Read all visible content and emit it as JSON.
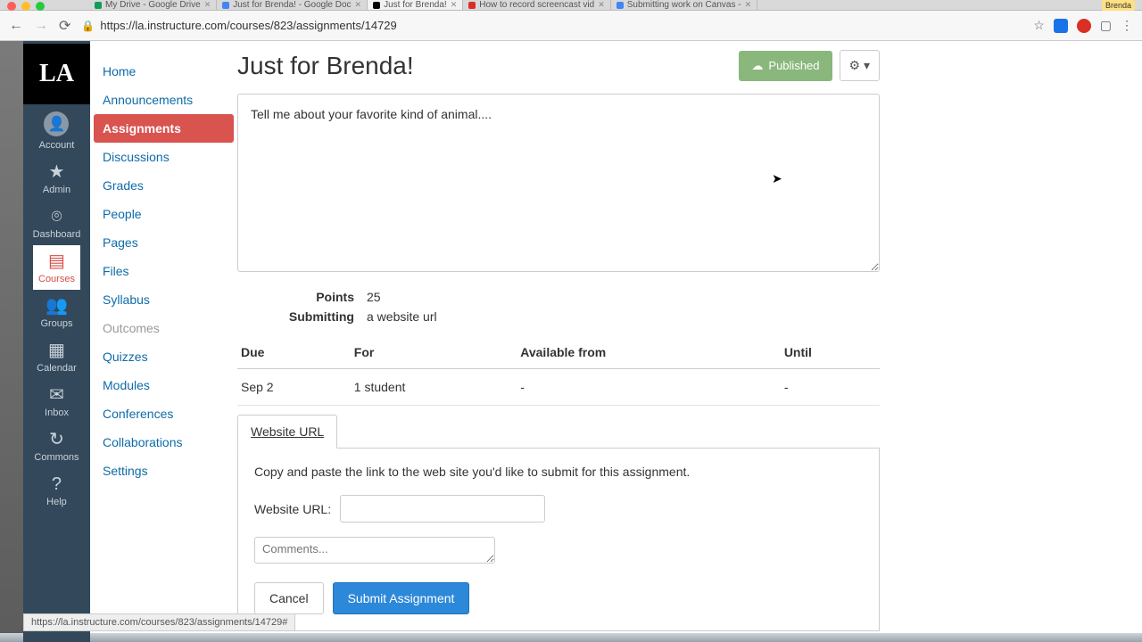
{
  "browser": {
    "user": "Brenda",
    "tabs": [
      {
        "label": "My Drive - Google Drive",
        "fav": "gd"
      },
      {
        "label": "Just for Brenda! - Google Doc",
        "fav": "doc"
      },
      {
        "label": "Just for Brenda!",
        "fav": "la",
        "active": true
      },
      {
        "label": "How to record screencast vid",
        "fav": "rec"
      },
      {
        "label": "Submitting work on Canvas -",
        "fav": "doc"
      }
    ],
    "url": "https://la.instructure.com/courses/823/assignments/14729",
    "status_url": "https://la.instructure.com/courses/823/assignments/14729#"
  },
  "global_nav": {
    "logo": "LA",
    "items": [
      {
        "label": "Account",
        "icon": "avatar"
      },
      {
        "label": "Admin",
        "icon": "★"
      },
      {
        "label": "Dashboard",
        "icon": "⌾"
      },
      {
        "label": "Courses",
        "icon": "▤",
        "active": true
      },
      {
        "label": "Groups",
        "icon": "👥"
      },
      {
        "label": "Calendar",
        "icon": "▦"
      },
      {
        "label": "Inbox",
        "icon": "✉"
      },
      {
        "label": "Commons",
        "icon": "↻"
      },
      {
        "label": "Help",
        "icon": "?"
      }
    ]
  },
  "course_nav": [
    {
      "label": "Home"
    },
    {
      "label": "Announcements"
    },
    {
      "label": "Assignments",
      "active": true
    },
    {
      "label": "Discussions"
    },
    {
      "label": "Grades"
    },
    {
      "label": "People"
    },
    {
      "label": "Pages"
    },
    {
      "label": "Files"
    },
    {
      "label": "Syllabus"
    },
    {
      "label": "Outcomes",
      "disabled": true
    },
    {
      "label": "Quizzes"
    },
    {
      "label": "Modules"
    },
    {
      "label": "Conferences"
    },
    {
      "label": "Collaborations"
    },
    {
      "label": "Settings"
    }
  ],
  "assignment": {
    "title": "Just for Brenda!",
    "published_label": "Published",
    "description": "Tell me about your favorite kind of animal....",
    "points_label": "Points",
    "points": "25",
    "submitting_label": "Submitting",
    "submitting": "a website url",
    "due_headers": {
      "due": "Due",
      "for": "For",
      "from": "Available from",
      "until": "Until"
    },
    "due_row": {
      "due": "Sep 2",
      "for": "1 student",
      "from": "-",
      "until": "-"
    },
    "submit": {
      "tab": "Website URL",
      "instructions": "Copy and paste the link to the web site you'd like to submit for this assignment.",
      "url_label": "Website URL:",
      "url_value": "",
      "comments_placeholder": "Comments...",
      "cancel": "Cancel",
      "submit": "Submit Assignment"
    }
  }
}
